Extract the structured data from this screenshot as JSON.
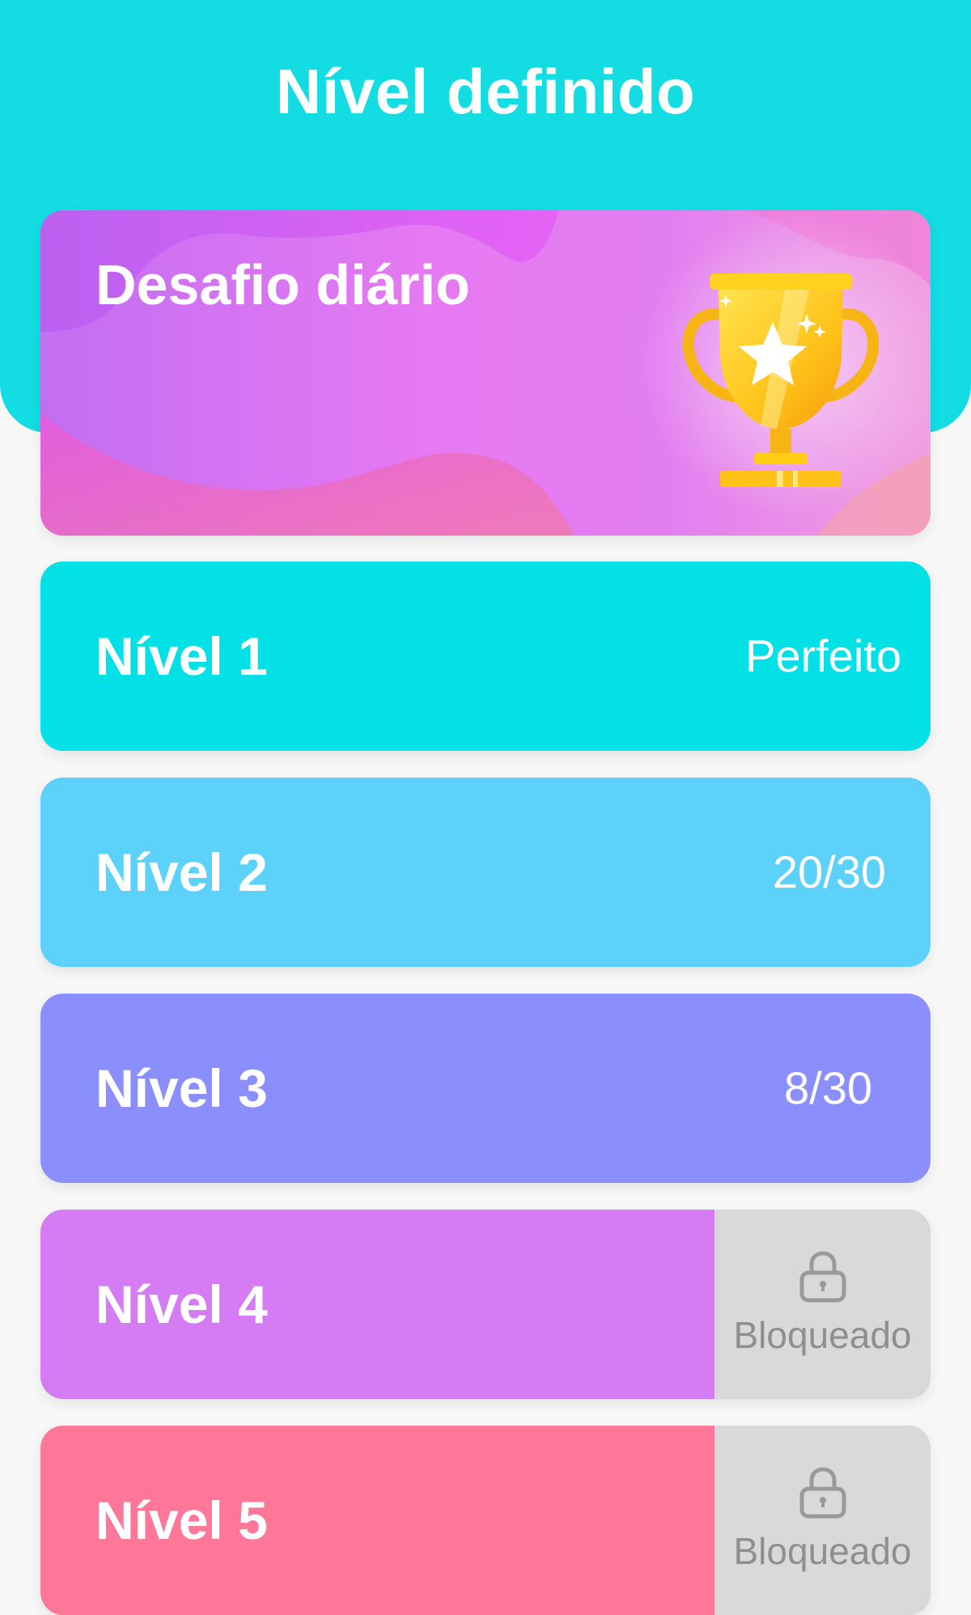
{
  "header": {
    "title": "Nível definido"
  },
  "daily_challenge": {
    "title": "Desafio diário",
    "icon": "trophy-icon"
  },
  "levels": [
    {
      "name": "Nível 1",
      "status": "Perfeito",
      "color": "#03e0e6",
      "locked": false
    },
    {
      "name": "Nível 2",
      "status": "20/30",
      "color": "#5cd2fb",
      "locked": false
    },
    {
      "name": "Nível 3",
      "status": "8/30",
      "color": "#8a8ffd",
      "locked": false
    },
    {
      "name": "Nível 4",
      "status": "Bloqueado",
      "color": "#d57bf3",
      "locked": true,
      "icon": "lock-icon"
    },
    {
      "name": "Nível 5",
      "status": "Bloqueado",
      "color": "#fe7799",
      "locked": true,
      "icon": "lock-icon"
    }
  ],
  "colors": {
    "header": "#13dde2",
    "locked_panel": "#d9d9d9",
    "locked_text": "#8f8f8f"
  }
}
